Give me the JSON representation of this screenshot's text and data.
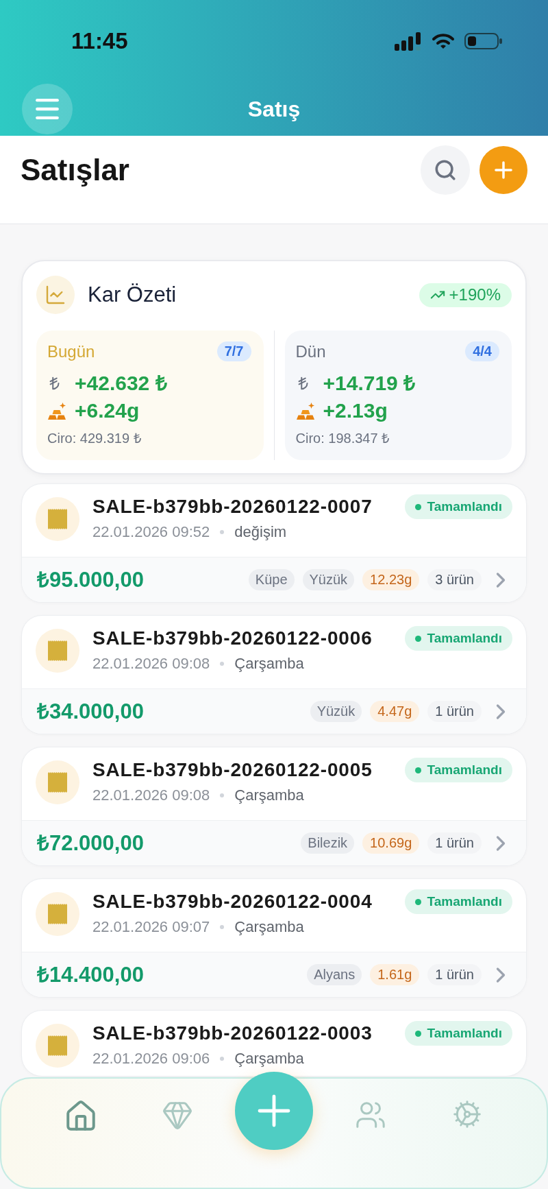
{
  "status_bar": {
    "time": "11:45"
  },
  "header": {
    "title": "Satış"
  },
  "page": {
    "title": "Satışlar"
  },
  "summary": {
    "title": "Kar Özeti",
    "change": "+190%",
    "periods": [
      {
        "label": "Bugün",
        "count": "7/7",
        "profit": "+42.632 ₺",
        "grams": "+6.24g",
        "revenue": "Ciro: 429.319 ₺",
        "highlighted": true
      },
      {
        "label": "Dün",
        "count": "4/4",
        "profit": "+14.719 ₺",
        "grams": "+2.13g",
        "revenue": "Ciro: 198.347 ₺",
        "highlighted": false
      }
    ]
  },
  "sales": [
    {
      "id": "SALE-b379bb-20260122-0007",
      "status": "Tamamlandı",
      "date": "22.01.2026 09:52",
      "note": "değişim",
      "amount": "₺95.000,00",
      "tags": [
        "Küpe",
        "Yüzük"
      ],
      "weight": "12.23g",
      "items": "3 ürün"
    },
    {
      "id": "SALE-b379bb-20260122-0006",
      "status": "Tamamlandı",
      "date": "22.01.2026 09:08",
      "note": "Çarşamba",
      "amount": "₺34.000,00",
      "tags": [
        "Yüzük"
      ],
      "weight": "4.47g",
      "items": "1 ürün"
    },
    {
      "id": "SALE-b379bb-20260122-0005",
      "status": "Tamamlandı",
      "date": "22.01.2026 09:08",
      "note": "Çarşamba",
      "amount": "₺72.000,00",
      "tags": [
        "Bilezik"
      ],
      "weight": "10.69g",
      "items": "1 ürün"
    },
    {
      "id": "SALE-b379bb-20260122-0004",
      "status": "Tamamlandı",
      "date": "22.01.2026 09:07",
      "note": "Çarşamba",
      "amount": "₺14.400,00",
      "tags": [
        "Alyans"
      ],
      "weight": "1.61g",
      "items": "1 ürün"
    },
    {
      "id": "SALE-b379bb-20260122-0003",
      "status": "Tamamlandı",
      "date": "22.01.2026 09:06",
      "note": "Çarşamba"
    }
  ],
  "bottom_nav": {
    "items": [
      {
        "selected": true
      },
      {
        "selected": false
      },
      {
        "selected": false
      },
      {
        "selected": false
      }
    ]
  }
}
